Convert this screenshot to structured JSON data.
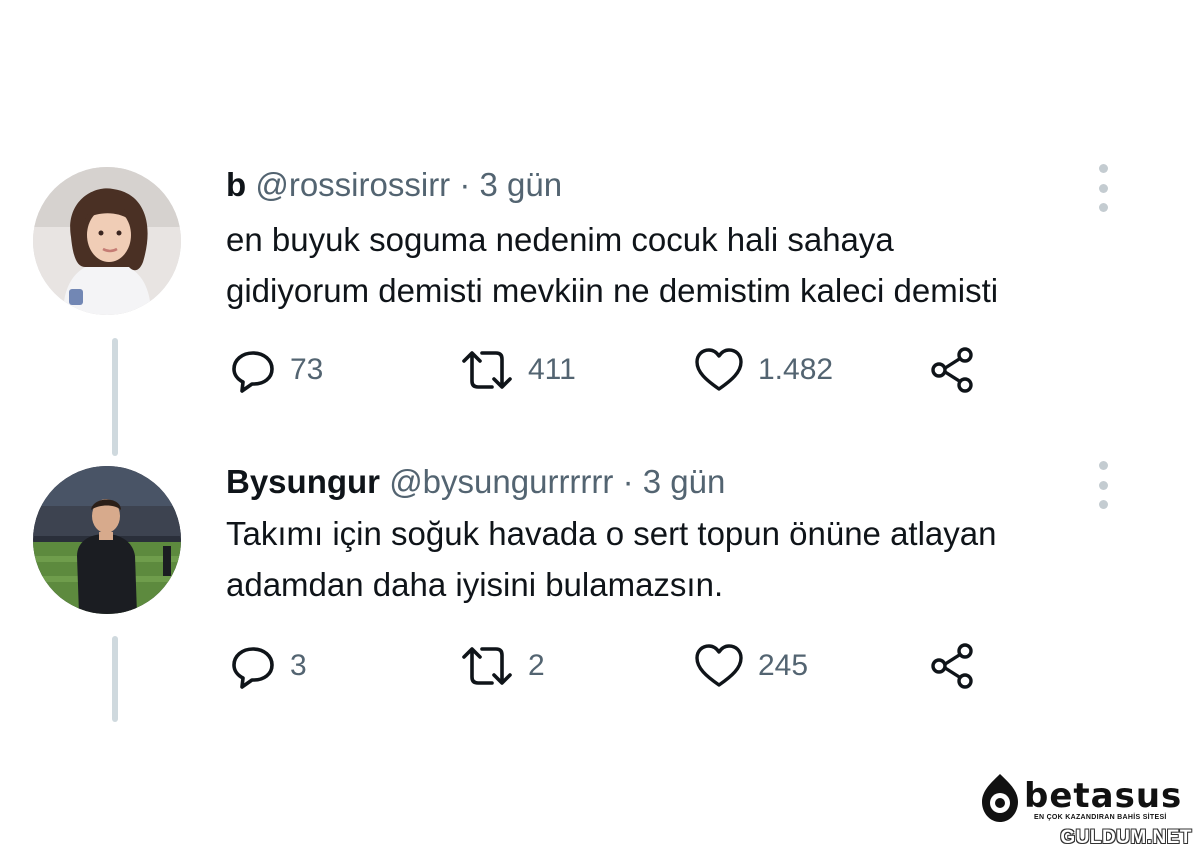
{
  "tweets": [
    {
      "name": "b",
      "handle": "@rossirossirr",
      "separator": "·",
      "time": "3 gün",
      "lines": [
        "en buyuk soguma nedenim cocuk hali sahaya",
        "gidiyorum demisti mevkiin ne demistim kaleci demisti"
      ],
      "replies": "73",
      "retweets": "411",
      "likes": "1.482",
      "avatar": "avatar-young-woman"
    },
    {
      "name": "Bysungur",
      "handle": "@bysungurrrrrr",
      "separator": "·",
      "time": "3 gün",
      "lines": [
        "Takımı için soğuk havada o sert topun önüne atlayan",
        "adamdan daha iyisini bulamazsın."
      ],
      "replies": "3",
      "retweets": "2",
      "likes": "245",
      "avatar": "avatar-man-in-stadium"
    }
  ],
  "icons": {
    "reply": "reply-icon",
    "retweet": "retweet-icon",
    "like": "heart-icon",
    "share": "share-icon",
    "more": "more-vertical-icon"
  },
  "branding": {
    "logo_text": "betasus",
    "logo_tagline": "EN ÇOK KAZANDIRAN BAHİS SİTESİ",
    "watermark": "GULDUM.NET"
  },
  "colors": {
    "text": "#0f1419",
    "secondary": "#536471",
    "thread_line": "#cfd9de",
    "background": "#ffffff"
  }
}
